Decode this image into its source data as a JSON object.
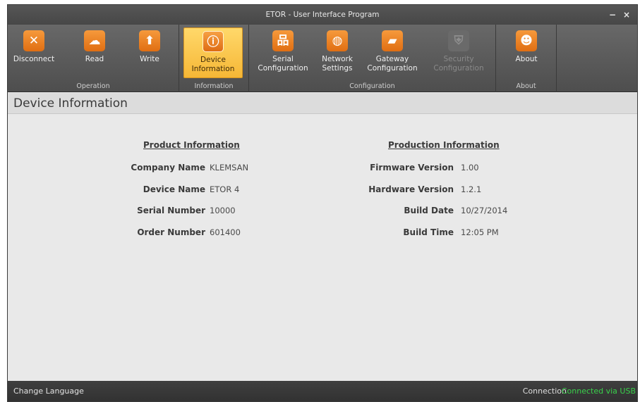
{
  "window": {
    "title": "ETOR - User Interface Program",
    "minimize_label": "−",
    "close_label": "×"
  },
  "ribbon": {
    "groups": [
      {
        "label": "Operation",
        "buttons": [
          {
            "label": "Disconnect",
            "icon": "close-icon",
            "glyph": "✕"
          },
          {
            "label": "Read",
            "icon": "cloud-download-icon",
            "glyph": "☁"
          },
          {
            "label": "Write",
            "icon": "cloud-upload-icon",
            "glyph": "⬆"
          }
        ]
      },
      {
        "label": "Information",
        "buttons": [
          {
            "label": "Device\nInformation",
            "icon": "info-icon",
            "glyph": "ⓘ",
            "active": true
          }
        ]
      },
      {
        "label": "Configuration",
        "buttons": [
          {
            "label": "Serial\nConfiguration",
            "icon": "network-tree-icon",
            "glyph": "品"
          },
          {
            "label": "Network\nSettings",
            "icon": "globe-icon",
            "glyph": "◍"
          },
          {
            "label": "Gateway\nConfiguration",
            "icon": "router-icon",
            "glyph": "▰"
          },
          {
            "label": "Security\nConfiguration",
            "icon": "shield-icon",
            "glyph": "⛨",
            "disabled": true
          }
        ]
      },
      {
        "label": "About",
        "buttons": [
          {
            "label": "About",
            "icon": "users-icon",
            "glyph": "☻"
          }
        ]
      }
    ]
  },
  "page": {
    "title": "Device Information"
  },
  "product_info": {
    "title": "Product Information",
    "rows": [
      {
        "label": "Company Name",
        "value": "KLEMSAN"
      },
      {
        "label": "Device Name",
        "value": "ETOR 4"
      },
      {
        "label": "Serial Number",
        "value": "10000"
      },
      {
        "label": "Order Number",
        "value": "601400"
      }
    ]
  },
  "production_info": {
    "title": "Production Information",
    "rows": [
      {
        "label": "Firmware Version",
        "value": "1.00"
      },
      {
        "label": "Hardware Version",
        "value": "1.2.1"
      },
      {
        "label": "Build Date",
        "value": "10/27/2014"
      },
      {
        "label": "Build Time",
        "value": "12:05 PM"
      }
    ]
  },
  "status": {
    "change_language": "Change Language",
    "connection_label": "Connection",
    "connection_value": "Connected via USB"
  },
  "colors": {
    "accent": "#f08a2a",
    "active_button": "#f6b736",
    "connected": "#38d04a"
  }
}
